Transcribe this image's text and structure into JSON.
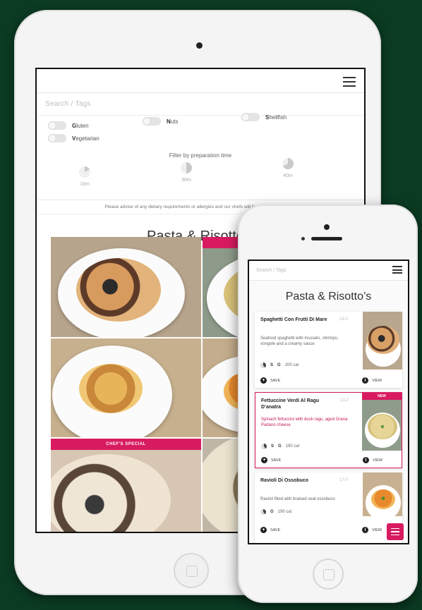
{
  "tablet": {
    "search_placeholder": "Search / Tags",
    "filters": [
      {
        "label": "Gluten",
        "initial": "G",
        "rest": "luten"
      },
      {
        "label": "Nuts",
        "initial": "N",
        "rest": "uts"
      },
      {
        "label": "Shellfish",
        "initial": "S",
        "rest": "hellfish"
      },
      {
        "label": "Vegetarian",
        "initial": "V",
        "rest": "egetarian"
      }
    ],
    "prep_title": "Filter by preparation time",
    "prep_options": [
      "10m",
      "30m",
      "40m"
    ],
    "disclaimer": "Please advise of any dietary requirements or allergies and our chefs will be delighted to assist.",
    "section_title": "Pasta & Risotto’s",
    "badges": {
      "new": "NEW",
      "special": "CHEF'S SPECIAL"
    }
  },
  "phone": {
    "search_placeholder": "Search / Tags",
    "section_title": "Pasta & Risotto’s",
    "items": [
      {
        "name": "Spaghetti Con Frutti Di Mare",
        "price": "16.0",
        "desc": "Seafood spaghetti with mussels, shrimps, vongole and a creamy sauce",
        "tags": [
          "S",
          "G"
        ],
        "cal": "200 cal",
        "save": "SAVE",
        "view": "VIEW",
        "badge": ""
      },
      {
        "name": "Fettuccine Verdi Al Ragu D’anatra",
        "price": "13.2",
        "desc": "Spinach fettuccini with duck ragu, aged Grana Padano cheese",
        "tags": [
          "S",
          "G"
        ],
        "cal": "190 cal",
        "save": "SAVE",
        "view": "VIEW",
        "badge": "NEW"
      },
      {
        "name": "Ravioli Di Ossobuco",
        "price": "17.0",
        "desc": "Ravioli filled with braised veal ossobuco",
        "tags": [
          "G"
        ],
        "cal": "190 cal",
        "save": "SAVE",
        "view": "VIEW",
        "badge": ""
      }
    ]
  },
  "colors": {
    "background": "#0b3b23",
    "accent": "#d81b60"
  }
}
